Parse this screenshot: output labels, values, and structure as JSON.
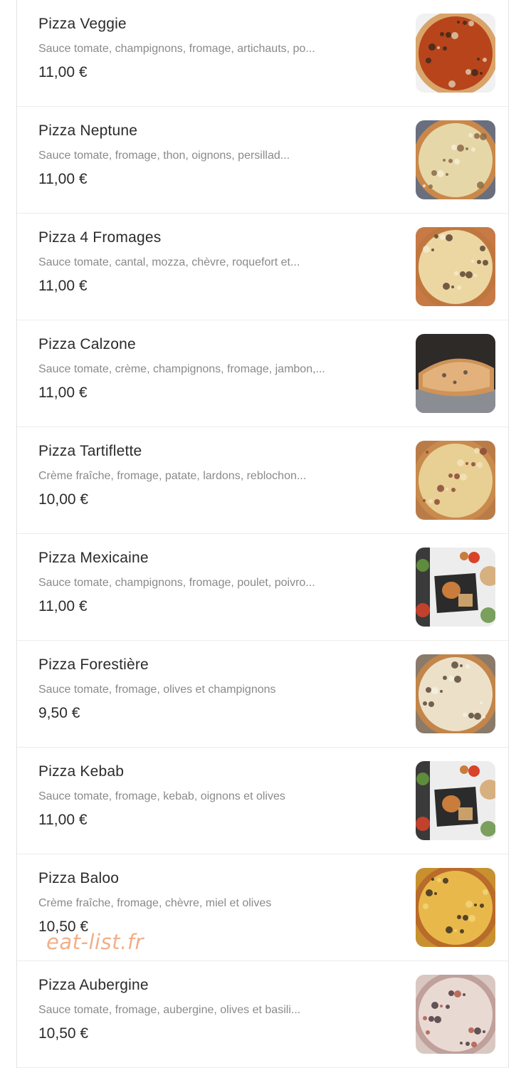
{
  "menu": {
    "items": [
      {
        "name": "Pizza Veggie",
        "description": "Sauce tomate, champignons, fromage, artichauts, po...",
        "price": "11,00 €",
        "photo": "pizza-veggie-photo",
        "photo_colors": {
          "bg": "#f1f1f1",
          "base": "#b8441c",
          "crust": "#d9a46a",
          "top": "#3d2a1a",
          "accent": "#d8c9a8"
        }
      },
      {
        "name": "Pizza Neptune",
        "description": "Sauce tomate, fromage, thon,  oignons, persillad...",
        "price": "11,00 €",
        "photo": "pizza-neptune-photo",
        "photo_colors": {
          "bg": "#6a6f7e",
          "base": "#e6d7a8",
          "crust": "#c9884a",
          "top": "#8a6a45",
          "accent": "#f3ecd6"
        }
      },
      {
        "name": "Pizza 4 Fromages",
        "description": "Sauce tomate, cantal, mozza, chèvre, roquefort et...",
        "price": "11,00 €",
        "photo": "pizza-4-fromages-photo",
        "photo_colors": {
          "bg": "#c77a45",
          "base": "#ecd7a2",
          "crust": "#c0773f",
          "top": "#5a4634",
          "accent": "#f5ead0"
        }
      },
      {
        "name": "Pizza Calzone",
        "description": "Sauce tomate, crème, champignons, fromage, jambon,...",
        "price": "11,00 €",
        "photo": "pizza-calzone-photo",
        "photo_colors": {
          "bg": "#2d2a28",
          "base": "#e3b27c",
          "crust": "#cf9358",
          "top": "#6b5a4b",
          "accent": "#8a8d93"
        }
      },
      {
        "name": "Pizza Tartiflette",
        "description": "Crème fraîche, fromage, patate, lardons, reblochon...",
        "price": "10,00 €",
        "photo": "pizza-tartiflette-photo",
        "photo_colors": {
          "bg": "#b97c48",
          "base": "#e8cf93",
          "crust": "#c98a4d",
          "top": "#8b4a3a",
          "accent": "#f2e3b8"
        }
      },
      {
        "name": "Pizza Mexicaine",
        "description": "Sauce tomate, champignons, fromage, poulet, poivro...",
        "price": "11,00 €",
        "photo": "pizza-mexicaine-photo",
        "photo_colors": {
          "bg": "#ededed",
          "base": "#2b2b2b",
          "crust": "#c97c3b",
          "top": "#5e8c3a",
          "accent": "#d9432a"
        }
      },
      {
        "name": "Pizza Forestière",
        "description": "Sauce tomate, fromage, olives et champignons",
        "price": "9,50 €",
        "photo": "pizza-forestiere-photo",
        "photo_colors": {
          "bg": "#8a7a6a",
          "base": "#ece1c8",
          "crust": "#c2854a",
          "top": "#5a4a3a",
          "accent": "#f6f0e2"
        }
      },
      {
        "name": "Pizza Kebab",
        "description": "Sauce tomate, fromage, kebab, oignons et olives",
        "price": "11,00 €",
        "photo": "pizza-kebab-photo",
        "photo_colors": {
          "bg": "#ededed",
          "base": "#2b2b2b",
          "crust": "#c97c3b",
          "top": "#5e8c3a",
          "accent": "#d9432a"
        }
      },
      {
        "name": "Pizza Baloo",
        "description": "Crème fraîche, fromage, chèvre, miel et olives",
        "price": "10,50 €",
        "photo": "pizza-baloo-photo",
        "photo_colors": {
          "bg": "#c8902f",
          "base": "#e8b94a",
          "crust": "#b86b2a",
          "top": "#3c2f22",
          "accent": "#f1d37a"
        }
      },
      {
        "name": "Pizza Aubergine",
        "description": "Sauce tomate, fromage, aubergine, olives et basili...",
        "price": "10,50 €",
        "photo": "pizza-aubergine-photo",
        "photo_colors": {
          "bg": "#d9c8c2",
          "base": "#e9d9d3",
          "crust": "#bfa09a",
          "top": "#4a3a40",
          "accent": "#b25a4a"
        }
      }
    ]
  },
  "watermark": {
    "text": "eat-list.fr",
    "color": "#f0a77c"
  }
}
